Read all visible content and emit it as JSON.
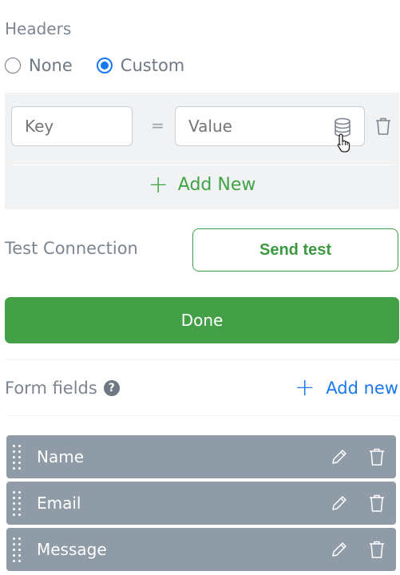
{
  "headers": {
    "label": "Headers",
    "options": [
      {
        "label": "None",
        "selected": false
      },
      {
        "label": "Custom",
        "selected": true
      }
    ],
    "key_placeholder": "Key",
    "separator": "=",
    "value_placeholder": "Value",
    "add_new_label": "Add New"
  },
  "test_connection": {
    "label": "Test Connection",
    "button_label": "Send test"
  },
  "done_label": "Done",
  "form_fields": {
    "label": "Form fields",
    "add_new_label": "Add new",
    "items": [
      {
        "label": "Name"
      },
      {
        "label": "Email"
      },
      {
        "label": "Message"
      }
    ]
  },
  "colors": {
    "accent_green": "#43a047",
    "accent_blue": "#1877f2",
    "row_background": "#8f9ba7",
    "panel_background": "#f0f2f3"
  },
  "icons": [
    "database-icon",
    "pointer-cursor-icon",
    "trash-icon",
    "plus-icon",
    "help-icon",
    "drag-handle-icon",
    "pencil-icon"
  ]
}
